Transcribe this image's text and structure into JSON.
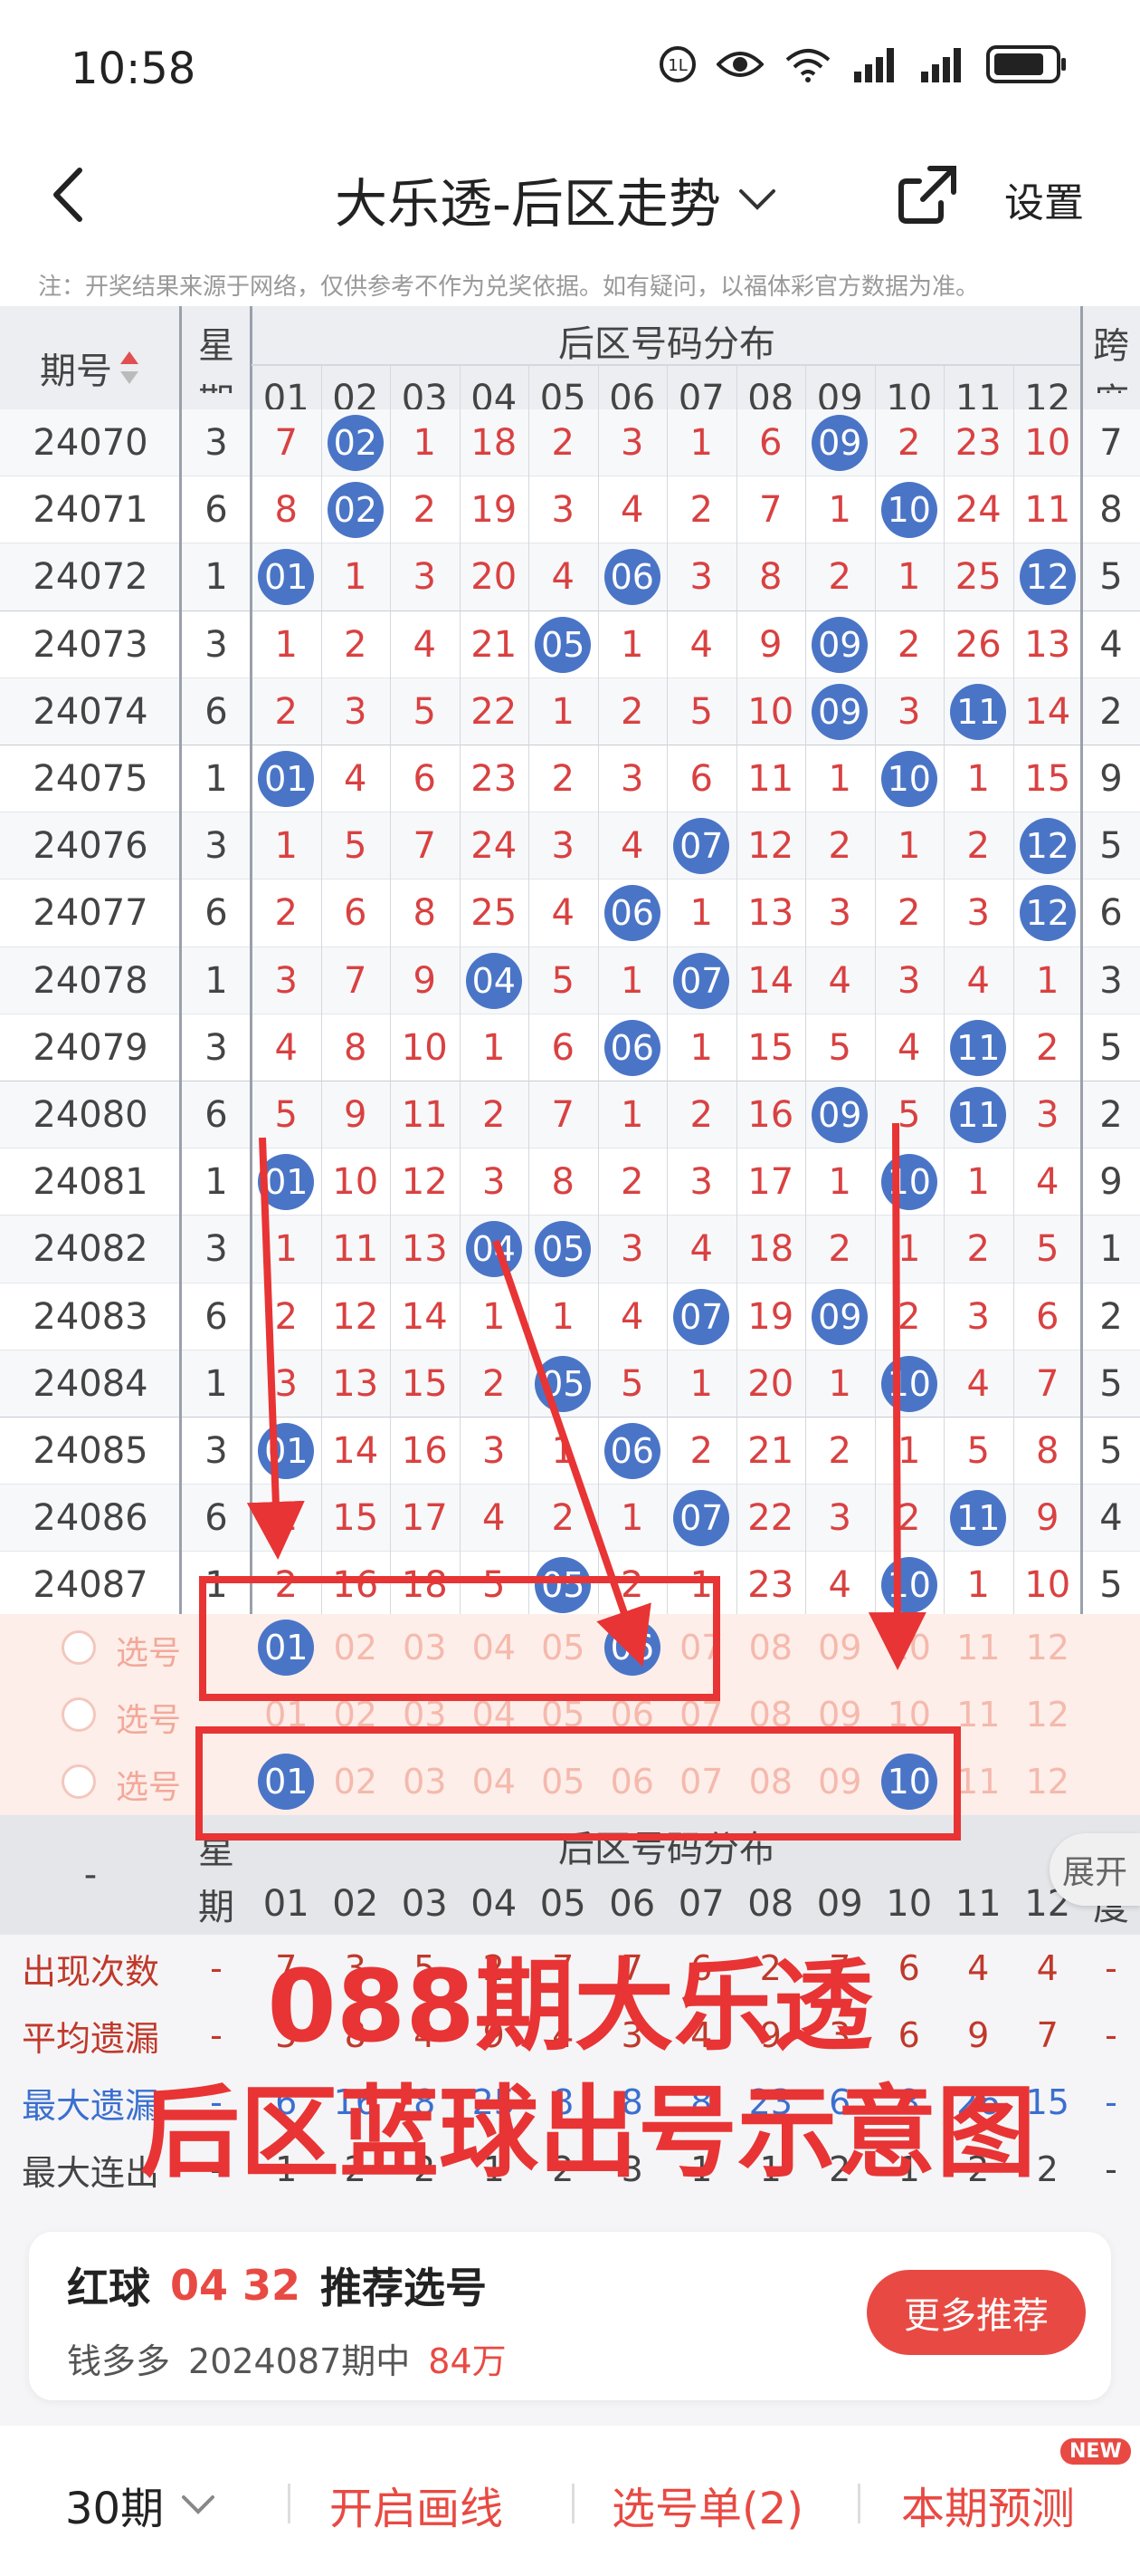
{
  "status_bar": {
    "time": "10:58"
  },
  "header": {
    "title": "大乐透-后区走势",
    "settings": "设置"
  },
  "note": "注：开奖结果来源于网络，仅供参考不作为兑奖依据。如有疑问，以福体彩官方数据为准。",
  "table": {
    "col_issue": "期号",
    "col_week_1": "星",
    "col_week_2": "期",
    "col_group": "后区号码分布",
    "col_span_1": "跨",
    "col_span_2": "度",
    "numbers": [
      "01",
      "02",
      "03",
      "04",
      "05",
      "06",
      "07",
      "08",
      "09",
      "10",
      "11",
      "12"
    ],
    "rows": [
      {
        "issue": "24070",
        "wk": "3",
        "cells": [
          "7",
          "02",
          "1",
          "18",
          "2",
          "3",
          "1",
          "6",
          "09",
          "2",
          "23",
          "10"
        ],
        "span": "7"
      },
      {
        "issue": "24071",
        "wk": "6",
        "cells": [
          "8",
          "02",
          "2",
          "19",
          "3",
          "4",
          "2",
          "7",
          "1",
          "10",
          "24",
          "11"
        ],
        "span": "8"
      },
      {
        "issue": "24072",
        "wk": "1",
        "cells": [
          "01",
          "1",
          "3",
          "20",
          "4",
          "06",
          "3",
          "8",
          "2",
          "1",
          "25",
          "12"
        ],
        "span": "5"
      },
      {
        "issue": "24073",
        "wk": "3",
        "cells": [
          "1",
          "2",
          "4",
          "21",
          "05",
          "1",
          "4",
          "9",
          "09",
          "2",
          "26",
          "13"
        ],
        "span": "4"
      },
      {
        "issue": "24074",
        "wk": "6",
        "cells": [
          "2",
          "3",
          "5",
          "22",
          "1",
          "2",
          "5",
          "10",
          "09",
          "3",
          "11",
          "14"
        ],
        "span": "2"
      },
      {
        "issue": "24075",
        "wk": "1",
        "cells": [
          "01",
          "4",
          "6",
          "23",
          "2",
          "3",
          "6",
          "11",
          "1",
          "10",
          "1",
          "15"
        ],
        "span": "9"
      },
      {
        "issue": "24076",
        "wk": "3",
        "cells": [
          "1",
          "5",
          "7",
          "24",
          "3",
          "4",
          "07",
          "12",
          "2",
          "1",
          "2",
          "12"
        ],
        "span": "5"
      },
      {
        "issue": "24077",
        "wk": "6",
        "cells": [
          "2",
          "6",
          "8",
          "25",
          "4",
          "06",
          "1",
          "13",
          "3",
          "2",
          "3",
          "12"
        ],
        "span": "6"
      },
      {
        "issue": "24078",
        "wk": "1",
        "cells": [
          "3",
          "7",
          "9",
          "04",
          "5",
          "1",
          "07",
          "14",
          "4",
          "3",
          "4",
          "1"
        ],
        "span": "3"
      },
      {
        "issue": "24079",
        "wk": "3",
        "cells": [
          "4",
          "8",
          "10",
          "1",
          "6",
          "06",
          "1",
          "15",
          "5",
          "4",
          "11",
          "2"
        ],
        "span": "5"
      },
      {
        "issue": "24080",
        "wk": "6",
        "cells": [
          "5",
          "9",
          "11",
          "2",
          "7",
          "1",
          "2",
          "16",
          "09",
          "5",
          "11",
          "3"
        ],
        "span": "2"
      },
      {
        "issue": "24081",
        "wk": "1",
        "cells": [
          "01",
          "10",
          "12",
          "3",
          "8",
          "2",
          "3",
          "17",
          "1",
          "10",
          "1",
          "4"
        ],
        "span": "9"
      },
      {
        "issue": "24082",
        "wk": "3",
        "cells": [
          "1",
          "11",
          "13",
          "04",
          "05",
          "3",
          "4",
          "18",
          "2",
          "1",
          "2",
          "5"
        ],
        "span": "1"
      },
      {
        "issue": "24083",
        "wk": "6",
        "cells": [
          "2",
          "12",
          "14",
          "1",
          "1",
          "4",
          "07",
          "19",
          "09",
          "2",
          "3",
          "6"
        ],
        "span": "2"
      },
      {
        "issue": "24084",
        "wk": "1",
        "cells": [
          "3",
          "13",
          "15",
          "2",
          "05",
          "5",
          "1",
          "20",
          "1",
          "10",
          "4",
          "7"
        ],
        "span": "5"
      },
      {
        "issue": "24085",
        "wk": "3",
        "cells": [
          "01",
          "14",
          "16",
          "3",
          "1",
          "06",
          "2",
          "21",
          "2",
          "1",
          "5",
          "8"
        ],
        "span": "5"
      },
      {
        "issue": "24086",
        "wk": "6",
        "cells": [
          "1",
          "15",
          "17",
          "4",
          "2",
          "1",
          "07",
          "22",
          "3",
          "2",
          "11",
          "9"
        ],
        "span": "4"
      },
      {
        "issue": "24087",
        "wk": "1",
        "cells": [
          "2",
          "16",
          "18",
          "5",
          "05",
          "2",
          "1",
          "23",
          "4",
          "10",
          "1",
          "10"
        ],
        "span": "5"
      }
    ],
    "pick_label": "选号",
    "picks": [
      {
        "selected": [
          "01",
          "06"
        ]
      },
      {
        "selected": []
      },
      {
        "selected": [
          "01",
          "10"
        ]
      }
    ]
  },
  "stats": {
    "dash": "-",
    "labels": [
      "出现次数",
      "平均遗漏",
      "最大遗漏",
      "最大连出"
    ],
    "label_colors": [
      "#c0392b",
      "#c0392b",
      "#3b6fcf",
      "#444"
    ],
    "rows": [
      [
        "-",
        "7",
        "3",
        "5",
        "2",
        "7",
        "7",
        "6",
        "2",
        "7",
        "6",
        "4",
        "4",
        "-"
      ],
      [
        "-",
        "3",
        "8",
        "4",
        "9",
        "4",
        "3",
        "4",
        "9",
        "3",
        "6",
        "9",
        "7",
        "-"
      ],
      [
        "-",
        "6",
        "16",
        "8",
        "25",
        "8",
        "8",
        "8",
        "23",
        "6",
        "8",
        "26",
        "15",
        "-"
      ],
      [
        "-",
        "1",
        "2",
        "2",
        "1",
        "2",
        "3",
        "1",
        "1",
        "2",
        "1",
        "2",
        "2",
        "-"
      ]
    ],
    "expand": "展开"
  },
  "overlay": {
    "line1": "088期大乐透",
    "line2": "后区蓝球出号示意图"
  },
  "card": {
    "red_ball_label": "红球",
    "red_ball_nums": "04 32",
    "recommend": "推荐选号",
    "author": "钱多多",
    "hit": "2024087期中",
    "amount": "84万",
    "more_button": "更多推荐"
  },
  "bottom": {
    "periods": "30期",
    "draw_line": "开启画线",
    "pick_list": "选号单(2)",
    "predict": "本期预测",
    "new_badge": "NEW"
  },
  "colors": {
    "ball": "#4a75c7",
    "red": "#e83434",
    "num_red": "#d94141"
  }
}
